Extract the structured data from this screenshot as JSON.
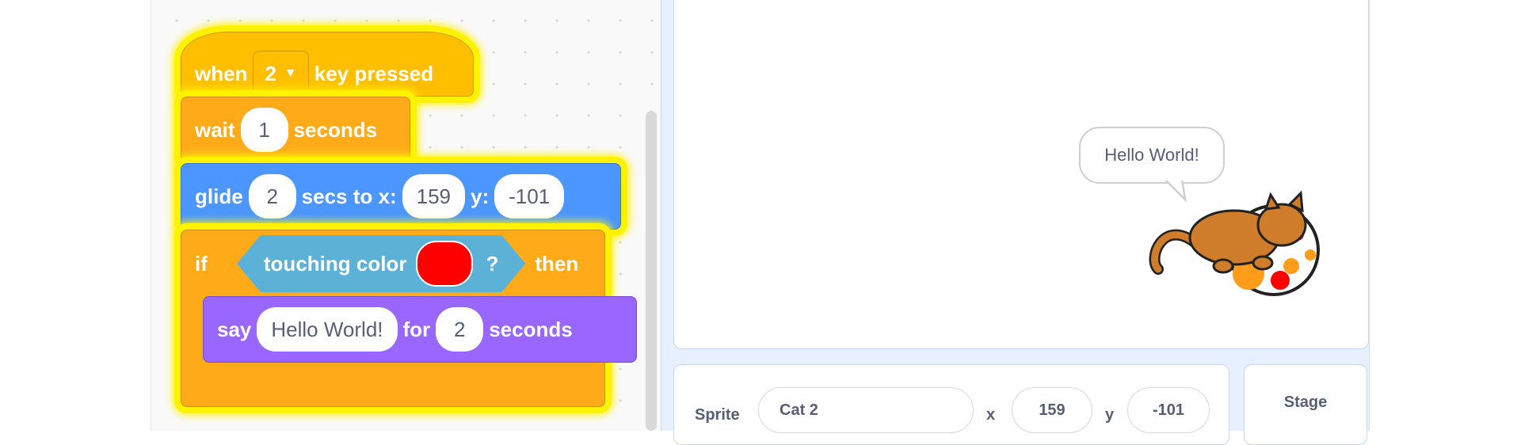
{
  "blocks": {
    "when_key": {
      "when": "when",
      "key": "2",
      "suffix": "key pressed"
    },
    "wait": {
      "label": "wait",
      "value": "1",
      "suffix": "seconds"
    },
    "glide": {
      "label": "glide",
      "secs": "2",
      "to_x": "secs to x:",
      "x": "159",
      "y_label": "y:",
      "y": "-101"
    },
    "if": {
      "label": "if",
      "then": "then"
    },
    "touching": {
      "label": "touching color",
      "q": "?",
      "color": "#ff0000"
    },
    "say": {
      "label": "say",
      "message": "Hello World!",
      "for": "for",
      "secs": "2",
      "suffix": "seconds"
    }
  },
  "stage": {
    "speech": "Hello World!"
  },
  "sprite_info": {
    "sprite_label": "Sprite",
    "name": "Cat 2",
    "x_label": "x",
    "x": "159",
    "y_label": "y",
    "y": "-101"
  },
  "stage_panel": {
    "label": "Stage"
  },
  "colors": {
    "event": "#ffbf00",
    "control": "#ffab19",
    "motion": "#4c97ff",
    "looks": "#9966ff",
    "sensing": "#5cb1d6",
    "highlight": "#fff200"
  }
}
